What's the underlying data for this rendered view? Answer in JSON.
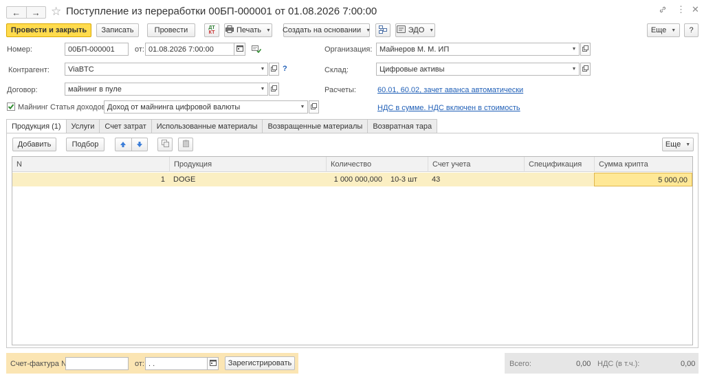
{
  "window": {
    "title": "Поступление из переработки 00БП-000001 от 01.08.2026 7:00:00"
  },
  "toolbar": {
    "post_close": "Провести и закрыть",
    "save": "Записать",
    "post": "Провести",
    "print": "Печать",
    "create_based": "Создать на основании",
    "edo": "ЭДО",
    "more": "Еще",
    "help": "?",
    "dtkt_top": "ДТ",
    "dtkt_bottom": "КТ"
  },
  "form": {
    "number_label": "Номер:",
    "number_value": "00БП-000001",
    "from_label": "от:",
    "date_value": "01.08.2026  7:00:00",
    "org_label": "Организация:",
    "org_value": "Майнеров М. М. ИП",
    "counterparty_label": "Контрагент:",
    "counterparty_value": "ViaBTC",
    "counterparty_help": "?",
    "warehouse_label": "Склад:",
    "warehouse_value": "Цифровые активы",
    "contract_label": "Договор:",
    "contract_value": "майнинг в пуле",
    "settlements_label": "Расчеты:",
    "settlements_link": "60.01, 60.02, зачет аванса автоматически",
    "mining_label": "Майнинг",
    "mining_checked": true,
    "income_item_label": "Статья доходов:",
    "income_item_value": "Доход от майнинга цифровой валюты",
    "vat_link": "НДС в сумме. НДС включен в стоимость"
  },
  "tabs": [
    {
      "label": "Продукция (1)",
      "active": true
    },
    {
      "label": "Услуги",
      "active": false
    },
    {
      "label": "Счет затрат",
      "active": false
    },
    {
      "label": "Использованные материалы",
      "active": false
    },
    {
      "label": "Возвращенные материалы",
      "active": false
    },
    {
      "label": "Возвратная тара",
      "active": false
    }
  ],
  "table_toolbar": {
    "add": "Добавить",
    "pick": "Подбор",
    "more": "Еще"
  },
  "table": {
    "columns": [
      "N",
      "Продукция",
      "Количество",
      "Счет учета",
      "Спецификация",
      "Сумма крипта"
    ],
    "rows": [
      {
        "n": "1",
        "product": "DOGE",
        "quantity": "1 000 000,000",
        "unit": "10-3 шт",
        "account": "43",
        "spec": "",
        "amount": "5 000,00"
      }
    ]
  },
  "footer": {
    "invoice_label": "Счет-фактура №:",
    "invoice_value": "",
    "from_label": "от:",
    "invoice_date_value": " .  .",
    "register_button": "Зарегистрировать",
    "total_label": "Всего:",
    "total_value": "0,00",
    "vat_label": "НДС (в т.ч.):",
    "vat_value": "0,00"
  },
  "colors": {
    "primary_button": "#ffdb4d",
    "selected_row": "#fbefc3",
    "selected_cell": "#ffe896",
    "link": "#1f5fb7",
    "checkbox_green": "#2e8b2e",
    "arrow_blue": "#3b7dd8"
  }
}
